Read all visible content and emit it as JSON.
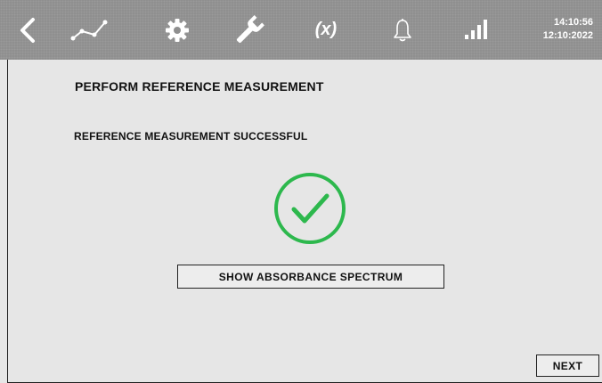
{
  "topbar": {
    "icons": [
      "back-chevron-icon",
      "trend-chart-icon",
      "gear-icon",
      "wrench-icon",
      "variable-icon",
      "bell-icon",
      "signal-bars-icon"
    ],
    "variable_label": "(x)",
    "time": "14:10:56",
    "date": "12:10:2022",
    "background_color": "#8f8f8f"
  },
  "main": {
    "title": "PERFORM REFERENCE MEASUREMENT",
    "status_text": "REFERENCE MEASUREMENT SUCCESSFUL",
    "success_icon": "check-circle-icon",
    "success_color": "#2db84d",
    "spectrum_button_label": "SHOW ABSORBANCE SPECTRUM"
  },
  "footer": {
    "next_label": "NEXT"
  }
}
